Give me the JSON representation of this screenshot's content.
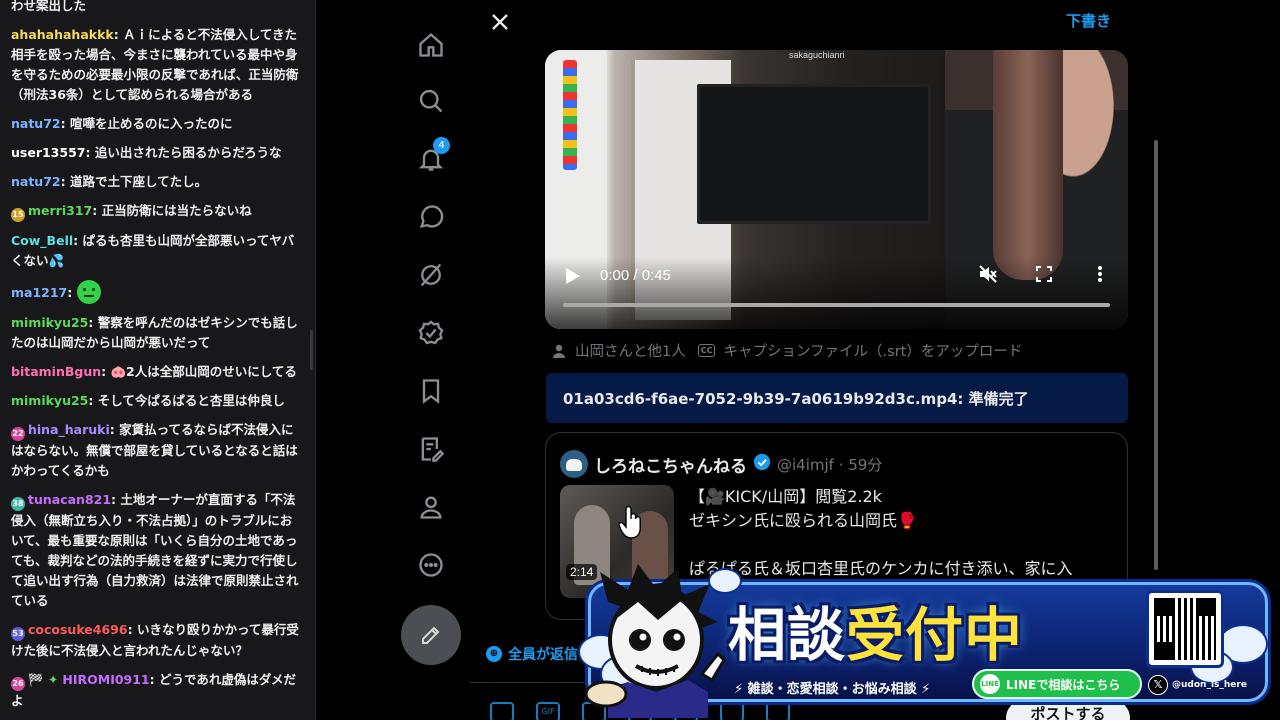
{
  "chat": {
    "messages": [
      {
        "user": "",
        "color": "#efeff1",
        "badge": "",
        "text": "わせ案出した"
      },
      {
        "user": "ahahahahakkk",
        "color": "#f6d95c",
        "badge": "",
        "text": "Ａｉによると不法侵入してきた相手を殴った場合、今まさに襲われている最中や身を守るための必要最小限の反撃であれば、正当防衛（刑法36条）として認められる場合がある"
      },
      {
        "user": "natu72",
        "color": "#7cb3ff",
        "badge": "",
        "text": "喧嘩を止めるのに入ったのに"
      },
      {
        "user": "user13557",
        "color": "#ffffff",
        "badge": "",
        "text": "追い出されたら困るからだろうな"
      },
      {
        "user": "natu72",
        "color": "#7cb3ff",
        "badge": "",
        "text": "道路で土下座してたし。"
      },
      {
        "user": "merri317",
        "color": "#5cd65c",
        "badge": "15",
        "badge_color": "#c9a227",
        "text": "正当防衛には当たらないね"
      },
      {
        "user": "Cow_Bell",
        "color": "#5ce0e0",
        "badge": "",
        "text": "ぱるも杏里も山岡が全部悪いってヤバくない💦"
      },
      {
        "user": "ma1217",
        "color": "#7cb3ff",
        "badge": "",
        "text": "",
        "emote": "green-face-emote"
      },
      {
        "user": "mimikyu25",
        "color": "#5cd65c",
        "badge": "",
        "text": "警察を呼んだのはゼキシンでも話したのは山岡だから山岡が悪いだって"
      },
      {
        "user": "bitaminBgun",
        "color": "#ff6fb5",
        "badge": "",
        "text": "🐽2人は全部山岡のせいにしてる"
      },
      {
        "user": "mimikyu25",
        "color": "#5cd65c",
        "badge": "",
        "text": "そして今ぱるぱると杏里は仲良し"
      },
      {
        "user": "hina_haruki",
        "color": "#a98bff",
        "badge": "22",
        "badge_color": "#d9449a",
        "text": "家賃払ってるならば不法侵入にはならない。無償で部屋を貸しているとなると話はかわってくるかも"
      },
      {
        "user": "tunacan821",
        "color": "#c86bff",
        "badge": "38",
        "badge_color": "#3fb8a5",
        "text": "土地オーナーが直面する「不法侵入（無断立ち入り・不法占拠）」のトラブルにおいて、最も重要な原則は「いくら自分の土地であっても、裁判などの法的手続きを経ずに実力で行使して追い出す行為（自力救済）は法律で原則禁止されている"
      },
      {
        "user": "cocosuke4696",
        "color": "#ff5a5a",
        "badge": "53",
        "badge_color": "#5b5be0",
        "text": "いきなり殴りかかって暴行受けた後に不法侵入と言われたんじゃない？"
      },
      {
        "user": "HIROMI0911",
        "color": "#c86bff",
        "badge": "26",
        "badge_color": "#d9449a",
        "extra_badges": "🏁 ✦",
        "text": "どうであれ虚偽はダメだよ"
      }
    ]
  },
  "nav": {
    "notifications_count": "4"
  },
  "modal": {
    "drafts_label": "下書き",
    "video": {
      "watermark": "sakaguchianri",
      "time": "0:00 / 0:45"
    },
    "tag_people": "山岡さんと他1人",
    "caption_badge": "CC",
    "caption_upload": "キャプションファイル（.srt）をアップロード",
    "upload_status": "01a03cd6-f6ae-7052-9b39-7a0619b92d3c.mp4: 準備完了",
    "quote": {
      "name": "しろねこちゃんねる",
      "handle": "@i4imjf · 59分",
      "duration": "2:14",
      "line1": "【🎥KICK/山岡】閲覧2.2k",
      "line2": "ゼキシン氏に殴られる山岡氏🥊",
      "line3": "ぱるぱる氏＆坂口杏里氏のケンカに付き添い、家に入"
    },
    "reply_setting": "全員が返信",
    "post_button": "ポストする"
  },
  "banner": {
    "title_a": "相談",
    "title_b": "受付中",
    "subtitle": "⚡ 雑談・恋愛相談・お悩み相談 ⚡",
    "line_label": "LINEで相談はこちら",
    "line_icon": "LINE",
    "x_handle": "@udon_is_here"
  },
  "colors": {
    "accent": "#1d9bf0",
    "chat_bg": "#18181b",
    "upload_bg": "#061a48"
  }
}
